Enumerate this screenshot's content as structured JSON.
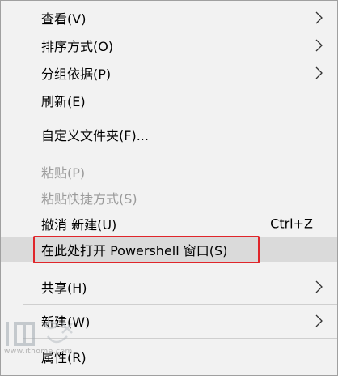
{
  "menu": {
    "items": [
      {
        "label": "查看(V)",
        "has_submenu": true
      },
      {
        "label": "排序方式(O)",
        "has_submenu": true
      },
      {
        "label": "分组依据(P)",
        "has_submenu": true
      },
      {
        "label": "刷新(E)"
      },
      {
        "label": "自定义文件夹(F)..."
      },
      {
        "label": "粘贴(P)",
        "disabled": true
      },
      {
        "label": "粘贴快捷方式(S)",
        "disabled": true
      },
      {
        "label": "撤消 新建(U)",
        "shortcut": "Ctrl+Z"
      },
      {
        "label": "在此处打开 Powershell 窗口(S)",
        "highlighted": true
      },
      {
        "label": "共享(H)",
        "has_submenu": true
      },
      {
        "label": "新建(W)",
        "has_submenu": true
      },
      {
        "label": "属性(R)"
      }
    ]
  },
  "colors": {
    "menu_background": "#f2f2f2",
    "highlight_background": "#dadada",
    "annotation_box": "#e0262b",
    "disabled_text": "#9a9a9a"
  },
  "watermark": {
    "text": "www.ithome.com"
  }
}
